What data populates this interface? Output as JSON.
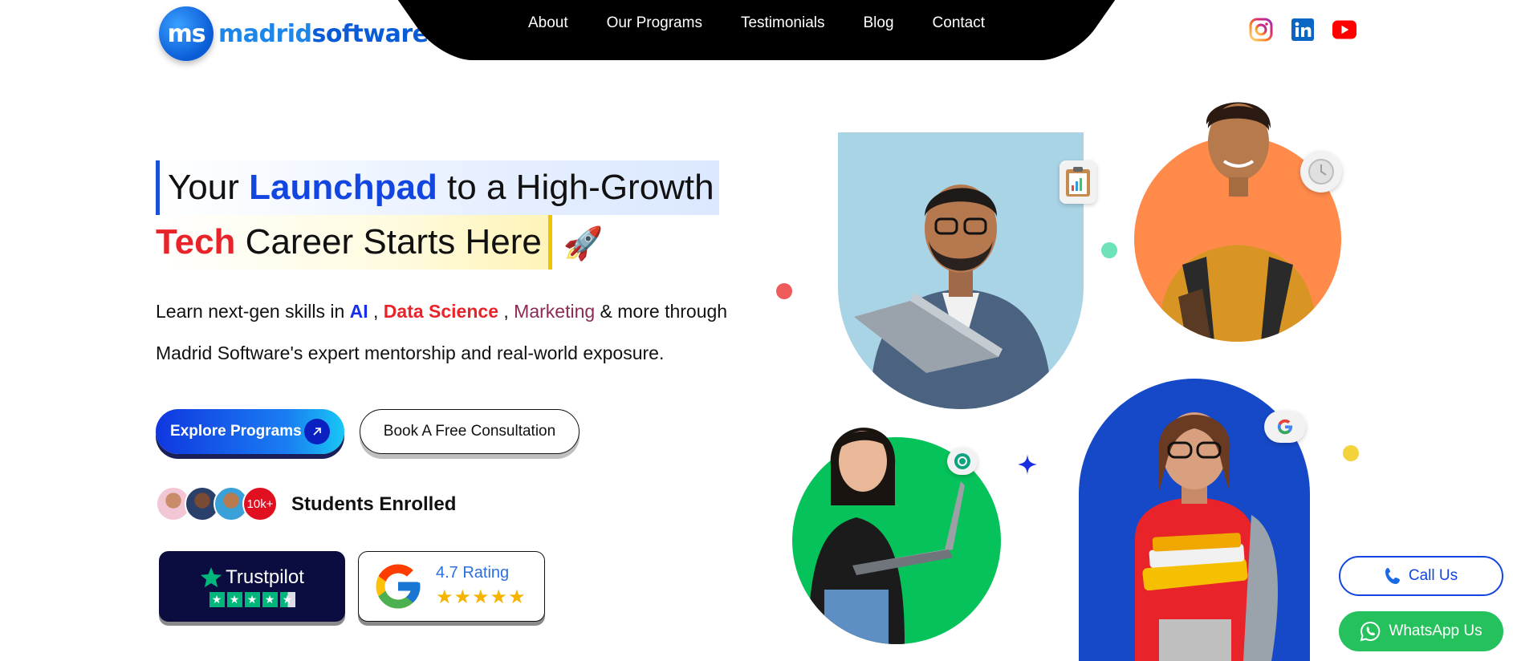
{
  "brand": {
    "badge": "ms",
    "name_part1": "madrid",
    "name_part2": "software"
  },
  "nav": {
    "items": [
      "About",
      "Our Programs",
      "Testimonials",
      "Blog",
      "Contact"
    ]
  },
  "socials": [
    "instagram-icon",
    "linkedin-icon",
    "youtube-icon"
  ],
  "hero": {
    "title_word1": "Your ",
    "title_highlight_blue": "Launchpad",
    "title_rest1": " to a High-Growth",
    "title_highlight_red": "Tech",
    "title_rest2": " Career Starts Here",
    "rocket": "🚀",
    "desc_prefix": "Learn next-gen skills in ",
    "desc_ai": "AI",
    "desc_sep1": " , ",
    "desc_ds": "Data Science",
    "desc_sep2": " , ",
    "desc_mk": "Marketing",
    "desc_suffix": " & more through Madrid Software's expert mentorship and real-world exposure."
  },
  "buttons": {
    "explore": "Explore Programs",
    "consult": "Book A Free Consultation"
  },
  "enrolled": {
    "count_badge": "10k+",
    "label": "Students Enrolled"
  },
  "trustpilot": {
    "name": "Trustpilot",
    "rating_stars": 4.5
  },
  "google": {
    "rating_label": "4.7 Rating",
    "stars": "★★★★★"
  },
  "contact": {
    "call": "Call Us",
    "whatsapp": "WhatsApp Us"
  },
  "colors": {
    "primary_blue": "#1346e0",
    "accent_red": "#e8242a",
    "green": "#06c25a",
    "orange": "#ff8a4a",
    "nav_black": "#000000"
  }
}
